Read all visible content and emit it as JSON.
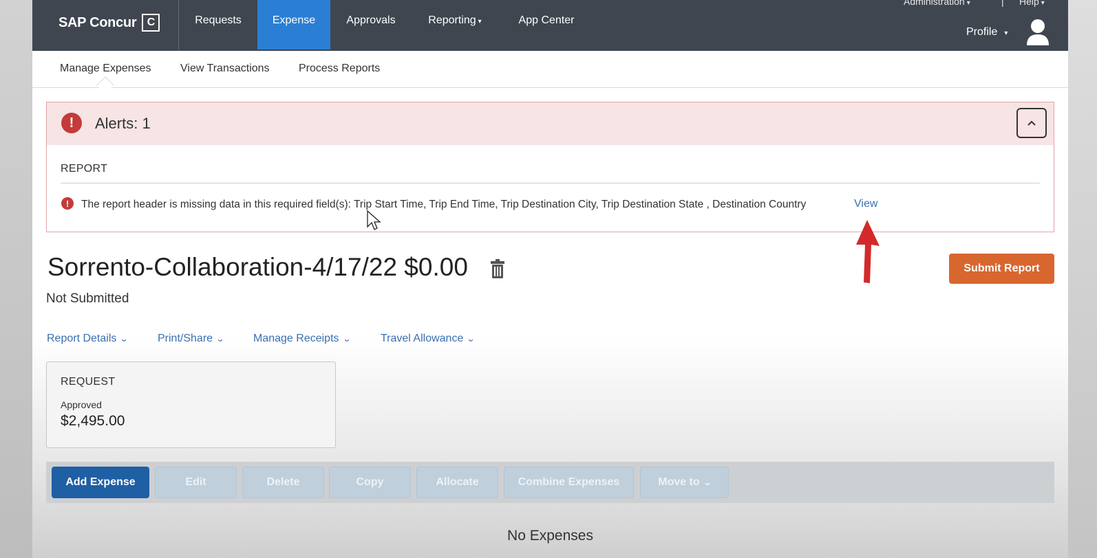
{
  "topnav": {
    "logo_text": "SAP Concur",
    "logo_mark": "C",
    "items": [
      {
        "label": "Requests"
      },
      {
        "label": "Expense"
      },
      {
        "label": "Approvals"
      },
      {
        "label": "Reporting"
      },
      {
        "label": "App Center"
      }
    ],
    "admin_label": "Administration",
    "separator": "|",
    "help_label": "Help",
    "profile_label": "Profile"
  },
  "subnav": {
    "items": [
      {
        "label": "Manage Expenses"
      },
      {
        "label": "View Transactions"
      },
      {
        "label": "Process Reports"
      }
    ]
  },
  "alert": {
    "title": "Alerts: 1",
    "section_label": "REPORT",
    "message": "The report header is missing data in this required field(s): Trip Start Time, Trip End Time, Trip Destination City, Trip Destination State , Destination Country",
    "link_label": "View",
    "icon_glyph": "!",
    "collapse_glyph": "^"
  },
  "report": {
    "title": "Sorrento-Collaboration-4/17/22 $0.00",
    "status": "Not Submitted",
    "submit_label": "Submit Report"
  },
  "menus": [
    {
      "label": "Report Details"
    },
    {
      "label": "Print/Share"
    },
    {
      "label": "Manage Receipts"
    },
    {
      "label": "Travel Allowance"
    }
  ],
  "request_card": {
    "title": "REQUEST",
    "status": "Approved",
    "amount": "$2,495.00"
  },
  "toolbar": {
    "buttons": [
      {
        "label": "Add Expense"
      },
      {
        "label": "Edit"
      },
      {
        "label": "Delete"
      },
      {
        "label": "Copy"
      },
      {
        "label": "Allocate"
      },
      {
        "label": "Combine Expenses"
      },
      {
        "label": "Move to"
      }
    ]
  },
  "empty_state": "No Expenses",
  "colors": {
    "nav_bg": "#3f4650",
    "nav_active": "#2a7fd4",
    "alert_red": "#c33b3b",
    "link_blue": "#3a6fb0",
    "submit_orange": "#d8672f",
    "primary_blue": "#1f5fa4"
  },
  "icons": [
    "alert-icon",
    "chevron-up-icon",
    "trash-icon",
    "avatar-icon",
    "chevron-down-icon",
    "mouse-cursor-icon",
    "red-arrow-annotation"
  ]
}
